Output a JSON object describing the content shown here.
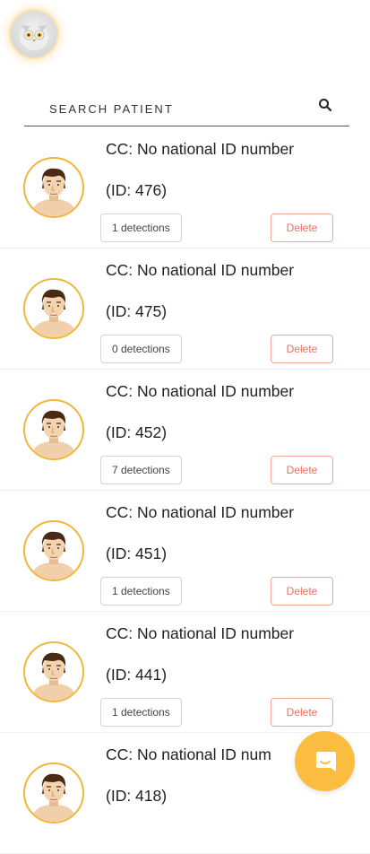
{
  "search": {
    "placeholder": "SEARCH PATIENT",
    "icon": "search-icon"
  },
  "logo": {
    "icon": "owl-logo-icon"
  },
  "colors": {
    "accent": "#fbbd3f",
    "avatar_ring": "#f2b63c",
    "delete": "#ee6f5c"
  },
  "patients": [
    {
      "name": "CC: No national ID number",
      "id_label": "(ID: 476)",
      "detections": "1 detections",
      "delete_label": "Delete"
    },
    {
      "name": "CC: No national ID number",
      "id_label": "(ID: 475)",
      "detections": "0 detections",
      "delete_label": "Delete"
    },
    {
      "name": "CC: No national ID number",
      "id_label": "(ID: 452)",
      "detections": "7 detections",
      "delete_label": "Delete"
    },
    {
      "name": "CC: No national ID number",
      "id_label": "(ID: 451)",
      "detections": "1 detections",
      "delete_label": "Delete"
    },
    {
      "name": "CC: No national ID number",
      "id_label": "(ID: 441)",
      "detections": "1 detections",
      "delete_label": "Delete"
    },
    {
      "name": "CC: No national ID num",
      "id_label": "(ID: 418)",
      "detections": "",
      "delete_label": ""
    }
  ],
  "chat": {
    "icon": "chat-icon"
  }
}
